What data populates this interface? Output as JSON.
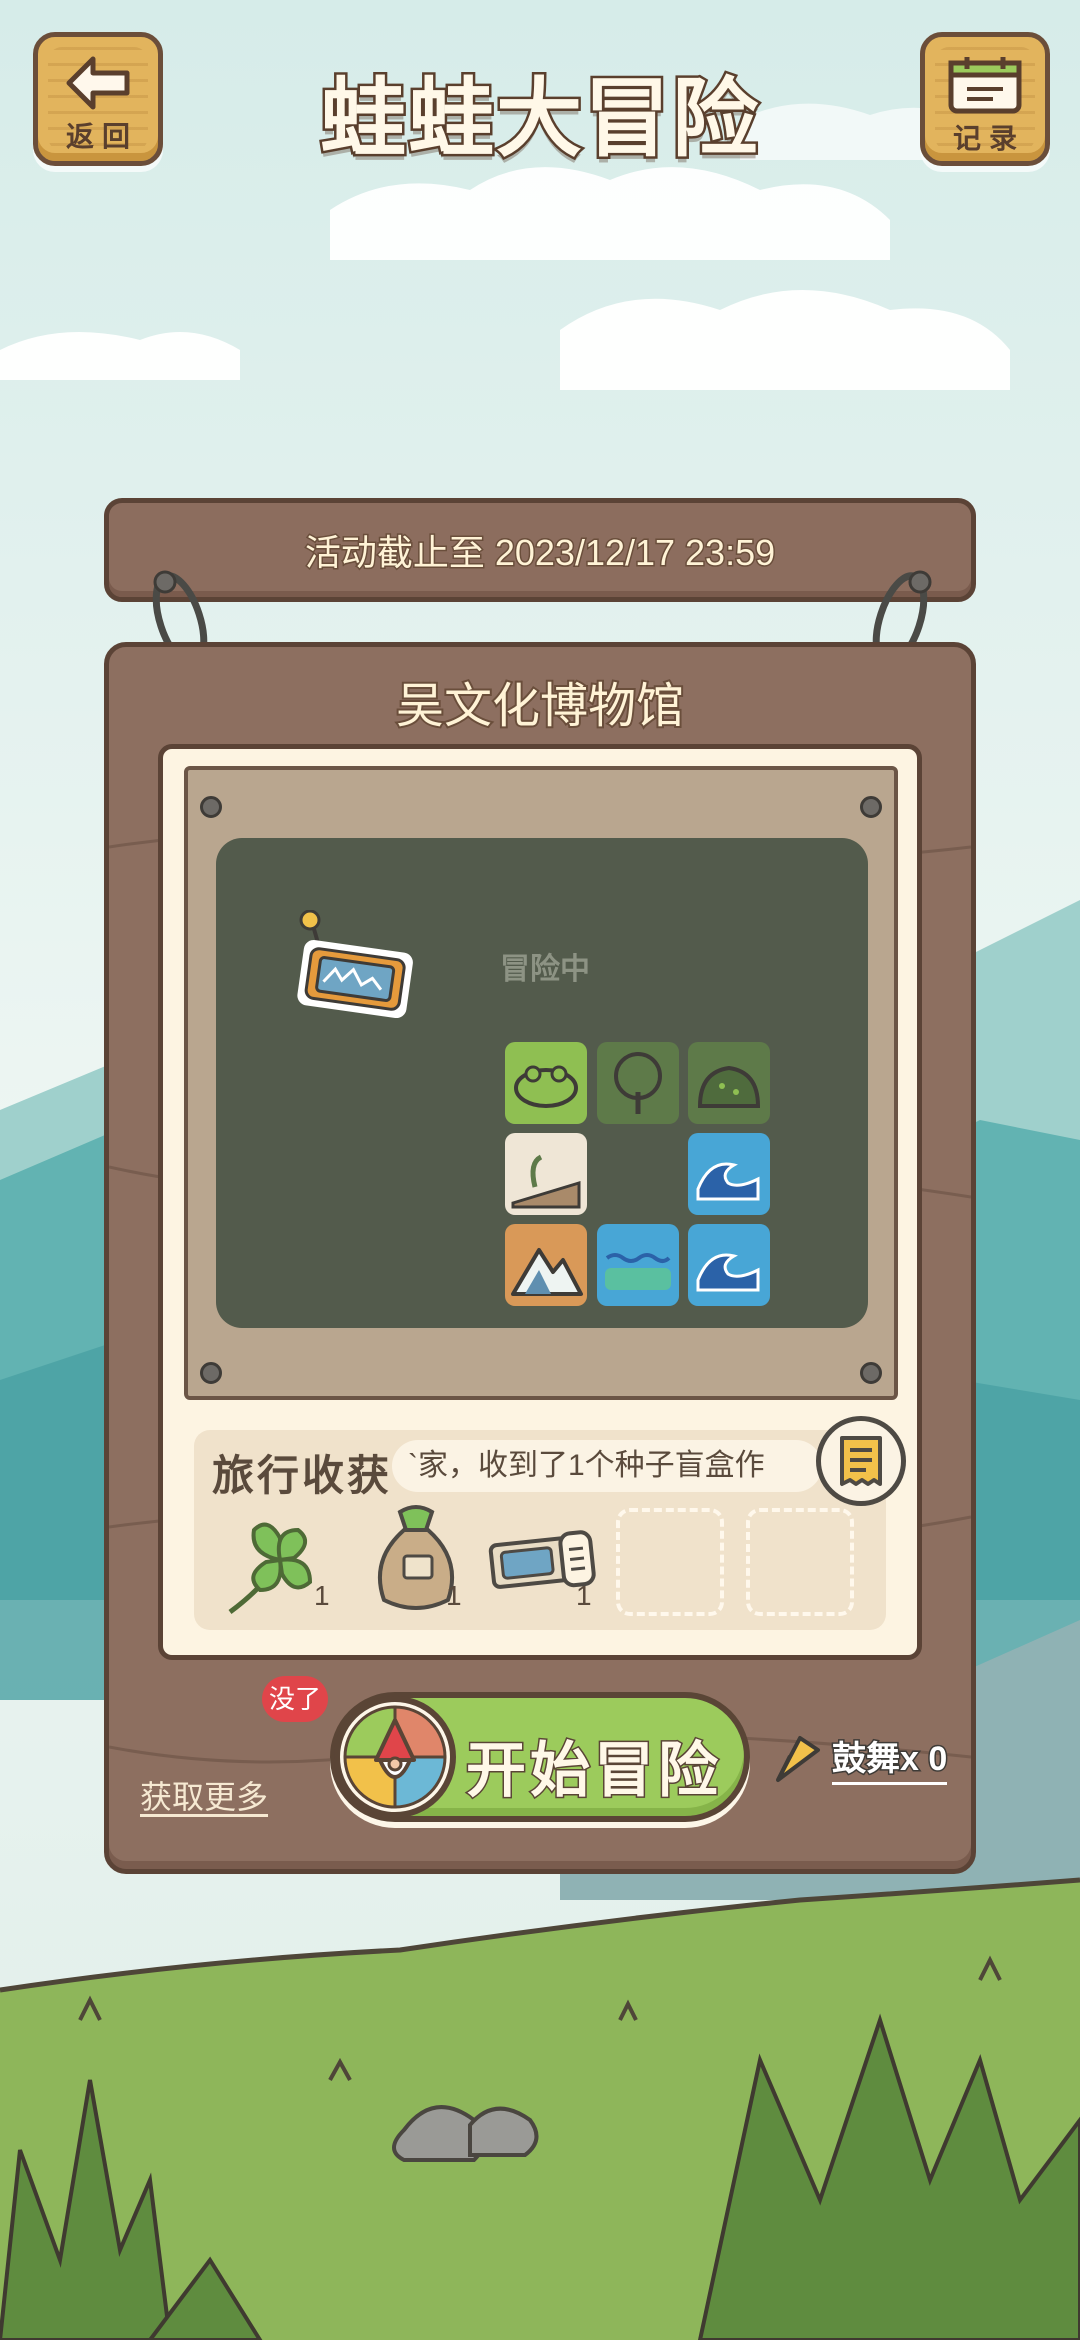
{
  "header": {
    "back_label": "返回",
    "title": "蛙蛙大冒险",
    "record_label": "记录"
  },
  "sign": {
    "deadline_text": "活动截止至 2023/12/17 23:59",
    "location": "吴文化博物馆"
  },
  "map": {
    "status": "冒险中",
    "tiles": [
      {
        "type": "frog",
        "color": "#8fbf52"
      },
      {
        "type": "tree",
        "color": "#5e7a49"
      },
      {
        "type": "bush",
        "color": "#5e7a49"
      },
      {
        "type": "path",
        "color": "#efe6d6"
      },
      {
        "type": "wave",
        "color": "#48a6d6"
      },
      {
        "type": "mountain",
        "color": "#d99958"
      },
      {
        "type": "water",
        "color": "#48a6d6"
      },
      {
        "type": "wave",
        "color": "#48a6d6"
      }
    ]
  },
  "loot": {
    "title": "旅行收获",
    "log_text": "`家，收到了1个种子盲盒作",
    "items": [
      {
        "icon": "clover-icon",
        "count": "1"
      },
      {
        "icon": "seed-bag-icon",
        "count": "1"
      },
      {
        "icon": "ticket-icon",
        "count": "1"
      }
    ],
    "empty_slots": 2
  },
  "controls": {
    "get_more": "获取更多",
    "empty_badge": "没了",
    "start_label": "开始冒险",
    "cheer_label": "鼓舞x 0"
  },
  "colors": {
    "wood": "#8d6f60",
    "wood_dark": "#5b4336",
    "button_green": "#9ccb5c",
    "cream": "#fdf4e2",
    "badge_red": "#e0454a"
  }
}
